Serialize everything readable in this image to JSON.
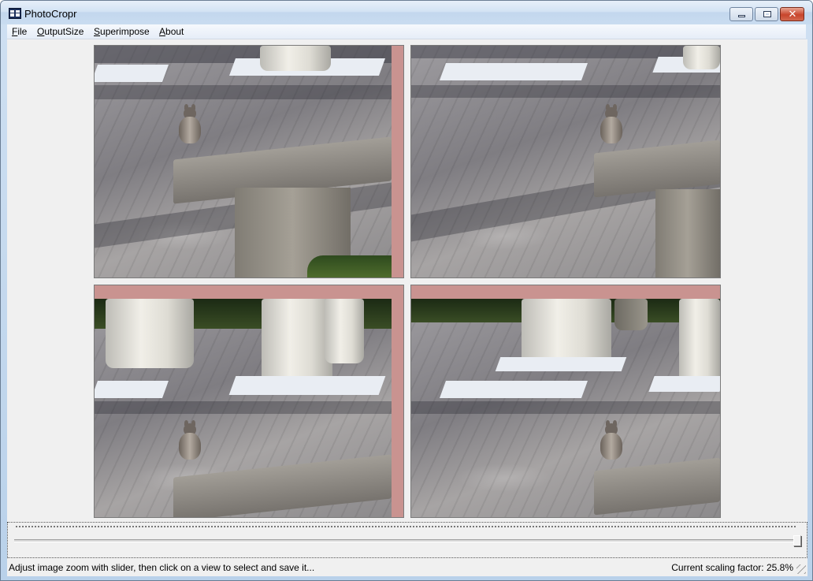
{
  "window": {
    "title": "PhotoCropr",
    "close_glyph": "✕"
  },
  "menu": {
    "items": [
      {
        "label": "File"
      },
      {
        "label": "OutputSize"
      },
      {
        "label": "Superimpose"
      },
      {
        "label": "About"
      }
    ]
  },
  "views": [
    {
      "name": "crop-view-top-left",
      "image": "squirrel on stone bench, left crop",
      "letterbox": "right"
    },
    {
      "name": "crop-view-top-right",
      "image": "squirrel on stone bench, right crop",
      "letterbox": "none"
    },
    {
      "name": "crop-view-bottom-left",
      "image": "squirrel on stone bench with columns, left crop",
      "letterbox": "top-and-right"
    },
    {
      "name": "crop-view-bottom-right",
      "image": "squirrel on stone bench with columns, right crop",
      "letterbox": "top"
    }
  ],
  "colors": {
    "letterbox": "#c99390",
    "client_background": "#f0f0f0",
    "title_gradient_top": "#e6eff9",
    "close_button": "#c8452c"
  },
  "zoom_slider": {
    "value_percent": 100
  },
  "status": {
    "hint": "Adjust image zoom with slider, then click on a view to select and save it...",
    "scaling": "Current scaling factor: 25.8%"
  },
  "icons": [
    "app-icon",
    "minimize-icon",
    "maximize-icon",
    "close-icon",
    "resize-grip-icon"
  ]
}
